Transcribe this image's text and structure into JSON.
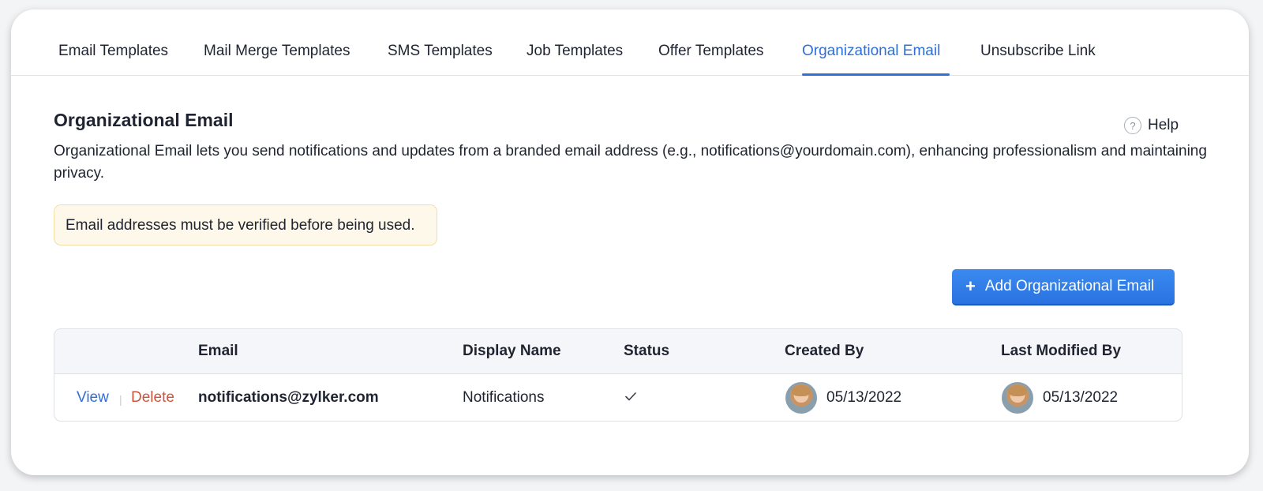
{
  "tabs": [
    {
      "label": "Email Templates"
    },
    {
      "label": "Mail Merge Templates"
    },
    {
      "label": "SMS Templates"
    },
    {
      "label": "Job Templates"
    },
    {
      "label": "Offer Templates"
    },
    {
      "label": "Organizational Email",
      "active": true
    },
    {
      "label": "Unsubscribe Link"
    }
  ],
  "page": {
    "title": "Organizational Email",
    "help_label": "Help",
    "help_icon_glyph": "?",
    "description": "Organizational Email lets you send notifications and updates from a branded email address (e.g., notifications@yourdomain.com), enhancing professionalism and maintaining privacy.",
    "notice": "Email addresses must be verified before being used.",
    "add_button_label": "Add Organizational Email",
    "add_button_icon": "+"
  },
  "table": {
    "headers": {
      "email": "Email",
      "display_name": "Display Name",
      "status": "Status",
      "created_by": "Created By",
      "last_modified_by": "Last Modified By"
    },
    "rows": [
      {
        "view_label": "View",
        "separator": "|",
        "delete_label": "Delete",
        "email": "notifications@zylker.com",
        "display_name": "Notifications",
        "status_icon": "check-icon",
        "created_date": "05/13/2022",
        "modified_date": "05/13/2022"
      }
    ]
  },
  "colors": {
    "accent": "#2f6fd6",
    "delete": "#d0533c",
    "button": "#2a72e1",
    "notice_bg": "#fdf8ea",
    "notice_border": "#f3dfa6"
  }
}
